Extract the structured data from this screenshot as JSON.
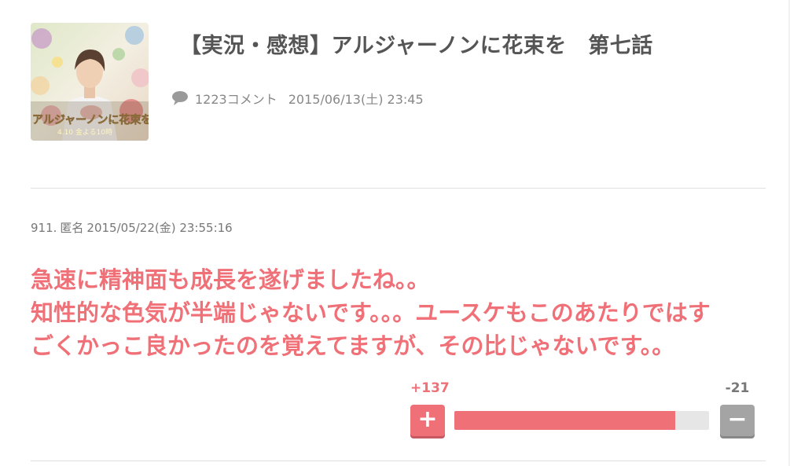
{
  "article": {
    "title": "【実況・感想】アルジャーノンに花束を　第七話",
    "comment_count": "1223コメント",
    "date": "2015/06/13(土) 23:45",
    "thumbnail": {
      "caption": "アルジャーノンに花束を",
      "subcaption": "4.10 金よる10時"
    }
  },
  "comment": {
    "number": "911.",
    "author": "匿名",
    "datetime": "2015/05/22(金) 23:55:16",
    "lines": [
      "急速に精神面も成長を遂げましたね。。",
      "知性的な色気が半端じゃないです。。。ユースケもこのあたりではす",
      "ごくかっこ良かったのを覚えてますが、その比じゃないです。。"
    ],
    "votes": {
      "plus": "+137",
      "minus": "-21",
      "plus_ratio": 0.867,
      "plus_label": "+",
      "minus_label": "−"
    }
  },
  "colors": {
    "accent": "#f07078",
    "muted": "#a4a4a4"
  }
}
